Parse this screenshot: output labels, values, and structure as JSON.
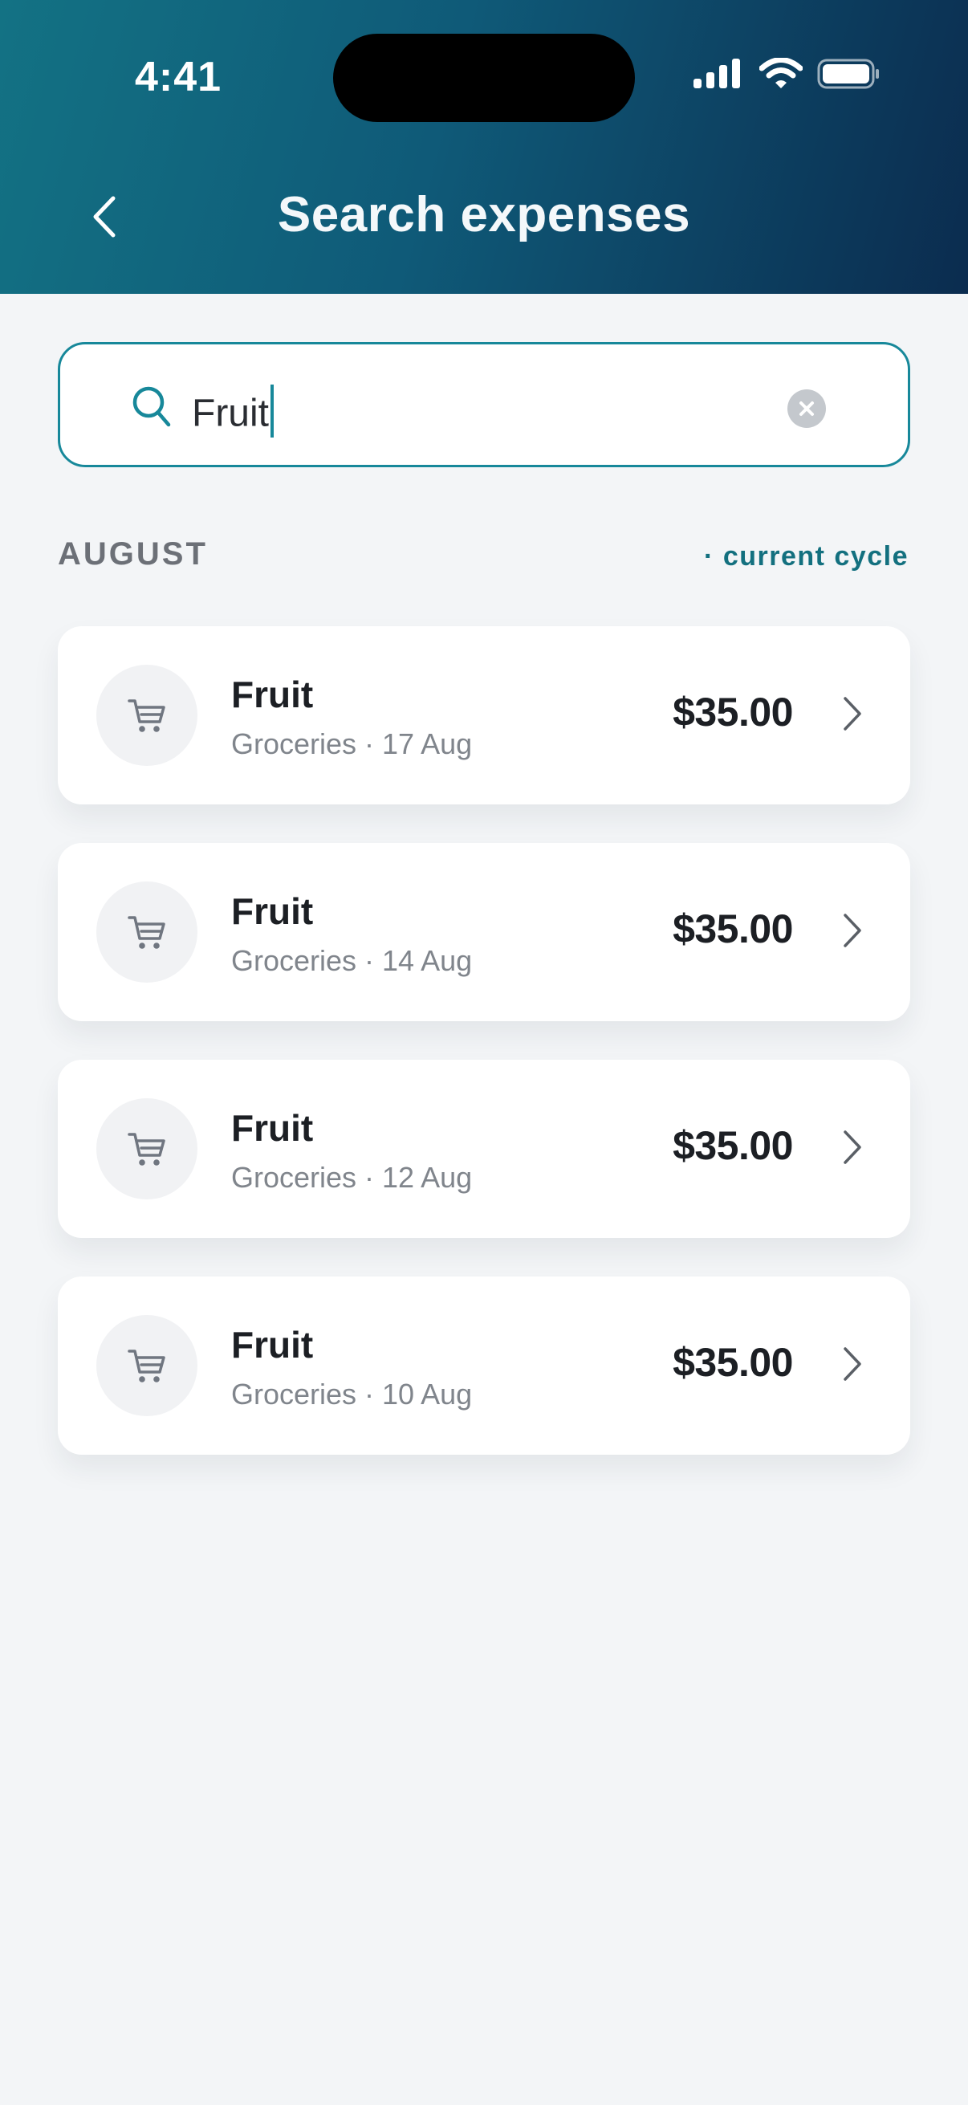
{
  "status_bar": {
    "time": "4:41"
  },
  "header": {
    "title": "Search expenses"
  },
  "search": {
    "value": "Fruit"
  },
  "section": {
    "label": "AUGUST",
    "cycle": "· current cycle"
  },
  "results": [
    {
      "title": "Fruit",
      "meta": "Groceries · 17 Aug",
      "amount": "$35.00",
      "icon": "cart-icon"
    },
    {
      "title": "Fruit",
      "meta": "Groceries · 14 Aug",
      "amount": "$35.00",
      "icon": "cart-icon"
    },
    {
      "title": "Fruit",
      "meta": "Groceries · 12 Aug",
      "amount": "$35.00",
      "icon": "cart-icon"
    },
    {
      "title": "Fruit",
      "meta": "Groceries · 10 Aug",
      "amount": "$35.00",
      "icon": "cart-icon"
    }
  ],
  "colors": {
    "accent": "#17889a",
    "header_start": "#137284",
    "header_end": "#0b2c4f",
    "background": "#f3f5f7"
  }
}
